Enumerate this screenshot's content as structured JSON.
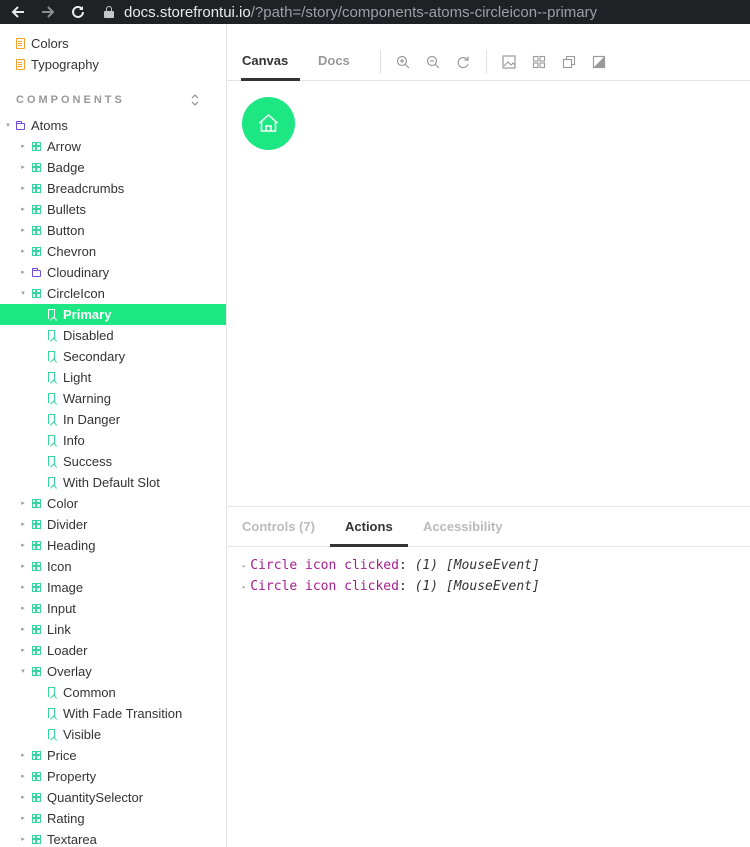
{
  "browser": {
    "url_host": "docs.storefrontui.io",
    "url_path": "/?path=/story/components-atoms-circleicon--primary"
  },
  "sidebar": {
    "top_items": [
      "Colors",
      "Typography"
    ],
    "section_header": "COMPONENTS",
    "tree": [
      {
        "label": "Atoms",
        "type": "folder",
        "expanded": true
      },
      {
        "label": "Arrow",
        "type": "component"
      },
      {
        "label": "Badge",
        "type": "component"
      },
      {
        "label": "Breadcrumbs",
        "type": "component"
      },
      {
        "label": "Bullets",
        "type": "component"
      },
      {
        "label": "Button",
        "type": "component"
      },
      {
        "label": "Chevron",
        "type": "component"
      },
      {
        "label": "Cloudinary",
        "type": "folder"
      },
      {
        "label": "CircleIcon",
        "type": "component",
        "expanded": true
      },
      {
        "label": "Primary",
        "type": "story",
        "active": true
      },
      {
        "label": "Disabled",
        "type": "story"
      },
      {
        "label": "Secondary",
        "type": "story"
      },
      {
        "label": "Light",
        "type": "story"
      },
      {
        "label": "Warning",
        "type": "story"
      },
      {
        "label": "In Danger",
        "type": "story"
      },
      {
        "label": "Info",
        "type": "story"
      },
      {
        "label": "Success",
        "type": "story"
      },
      {
        "label": "With Default Slot",
        "type": "story"
      },
      {
        "label": "Color",
        "type": "component"
      },
      {
        "label": "Divider",
        "type": "component"
      },
      {
        "label": "Heading",
        "type": "component"
      },
      {
        "label": "Icon",
        "type": "component"
      },
      {
        "label": "Image",
        "type": "component"
      },
      {
        "label": "Input",
        "type": "component"
      },
      {
        "label": "Link",
        "type": "component"
      },
      {
        "label": "Loader",
        "type": "component"
      },
      {
        "label": "Overlay",
        "type": "component",
        "expanded": true
      },
      {
        "label": "Common",
        "type": "story"
      },
      {
        "label": "With Fade Transition",
        "type": "story"
      },
      {
        "label": "Visible",
        "type": "story"
      },
      {
        "label": "Price",
        "type": "component"
      },
      {
        "label": "Property",
        "type": "component"
      },
      {
        "label": "QuantitySelector",
        "type": "component"
      },
      {
        "label": "Rating",
        "type": "component"
      },
      {
        "label": "Textarea",
        "type": "component"
      }
    ]
  },
  "toolbar": {
    "tabs": [
      "Canvas",
      "Docs"
    ],
    "active_tab": "Canvas",
    "tools": [
      "zoom-in-icon",
      "zoom-out-icon",
      "reset-zoom-icon",
      "background-icon",
      "grid-icon",
      "viewport-icon",
      "outline-icon"
    ]
  },
  "preview": {
    "button_color": "#1ce783",
    "icon": "home-icon"
  },
  "addons": {
    "tabs": [
      "Controls (7)",
      "Actions",
      "Accessibility"
    ],
    "active_tab": "Actions",
    "log": [
      {
        "name": "Circle icon clicked",
        "colon": ":",
        "count": "(1)",
        "value": "[MouseEvent]"
      },
      {
        "name": "Circle icon clicked",
        "colon": ":",
        "count": "(1)",
        "value": "[MouseEvent]"
      }
    ]
  },
  "colors": {
    "accent": "#1ce783",
    "action_name": "#a51e8f"
  }
}
